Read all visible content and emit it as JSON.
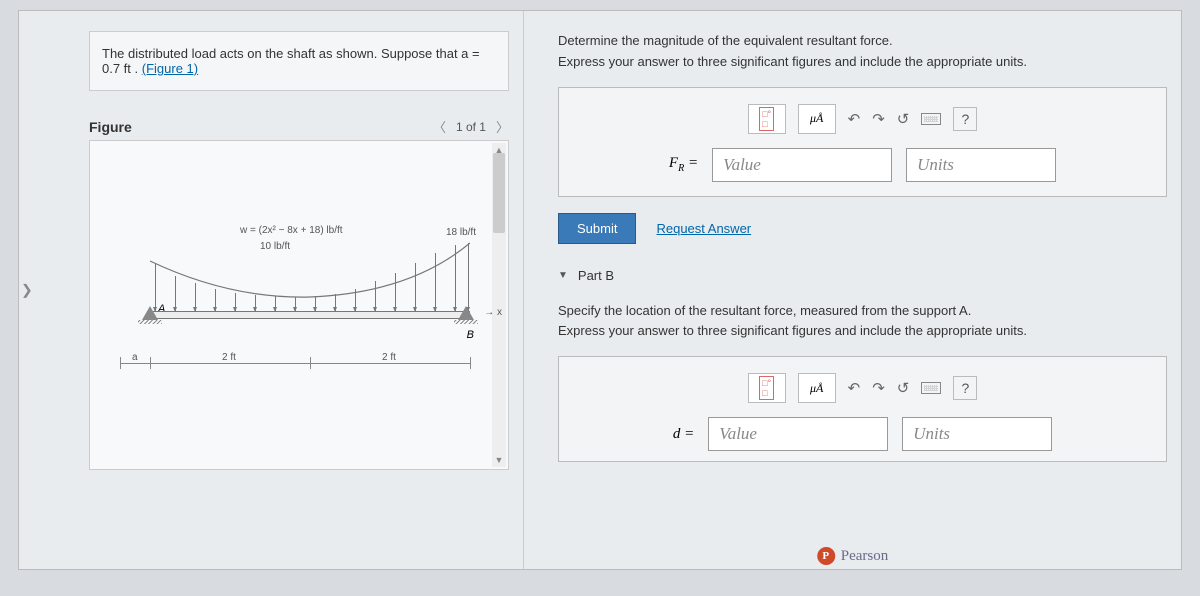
{
  "problem": {
    "text_before_link": "The distributed load acts on the shaft as shown. Suppose that a = 0.7 ft . ",
    "link": "(Figure 1)"
  },
  "figure": {
    "title": "Figure",
    "pager": "1 of 1",
    "eq": "w = (2x² − 8x + 18) lb/ft",
    "l10": "10 lb/ft",
    "l18": "18 lb/ft",
    "A": "A",
    "B": "B",
    "x": "x",
    "a": "a",
    "d1": "2 ft",
    "d2": "2 ft"
  },
  "partA": {
    "line1": "Determine the magnitude of the equivalent resultant force.",
    "line2": "Express your answer to three significant figures and include the appropriate units.",
    "mu": "μÅ",
    "var": "F",
    "sub": "R",
    "eq": " = ",
    "value_ph": "Value",
    "units_ph": "Units",
    "submit": "Submit",
    "req": "Request Answer",
    "q": "?"
  },
  "partB": {
    "head": "Part B",
    "line1": "Specify the location of the resultant force, measured from the support A.",
    "line2": "Express your answer to three significant figures and include the appropriate units.",
    "mu": "μÅ",
    "var": "d",
    "eq": " = ",
    "value_ph": "Value",
    "units_ph": "Units",
    "q": "?"
  },
  "brand": "Pearson"
}
